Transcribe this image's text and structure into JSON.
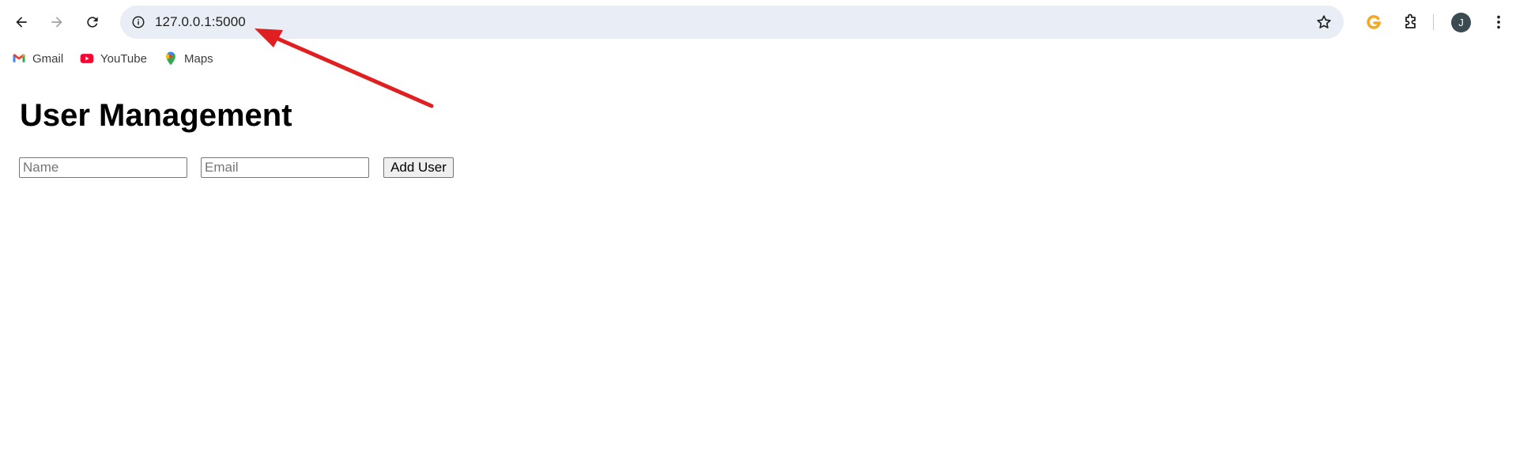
{
  "browser": {
    "url": "127.0.0.1:5000",
    "avatar_initial": "J",
    "bookmarks": [
      {
        "label": "Gmail",
        "icon": "gmail-icon"
      },
      {
        "label": "YouTube",
        "icon": "youtube-icon"
      },
      {
        "label": "Maps",
        "icon": "maps-icon"
      }
    ]
  },
  "page": {
    "title": "User Management",
    "form": {
      "name_placeholder": "Name",
      "name_value": "",
      "email_placeholder": "Email",
      "email_value": "",
      "add_button_label": "Add User"
    }
  },
  "annotation": {
    "arrow_color": "#e02020"
  }
}
